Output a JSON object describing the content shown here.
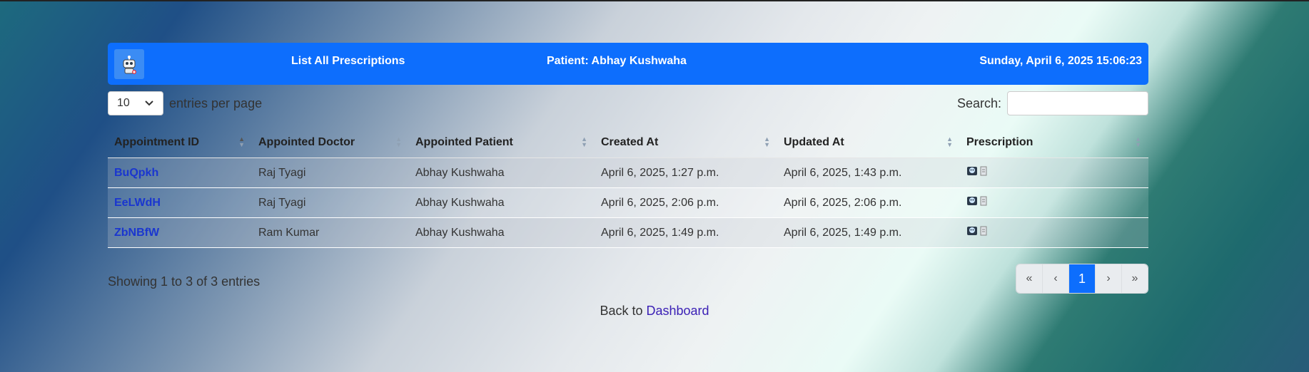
{
  "header": {
    "title": "List All Prescriptions",
    "patient": "Patient: Abhay Kushwaha",
    "datetime": "Sunday, April 6, 2025 15:06:23",
    "logo_icon": "robot-doctor-icon",
    "bar_color": "#0d6efd"
  },
  "controls": {
    "per_page_value": "10",
    "per_page_label": "entries per page",
    "search_label": "Search:",
    "search_placeholder": ""
  },
  "table": {
    "columns": [
      "Appointment ID",
      "Appointed Doctor",
      "Appointed Patient",
      "Created At",
      "Updated At",
      "Prescription"
    ],
    "rows": [
      {
        "id": "BuQpkh",
        "doctor": "Raj Tyagi",
        "patient": "Abhay Kushwaha",
        "created": "April 6, 2025, 1:27 p.m.",
        "updated": "April 6, 2025, 1:43 p.m."
      },
      {
        "id": "EeLWdH",
        "doctor": "Raj Tyagi",
        "patient": "Abhay Kushwaha",
        "created": "April 6, 2025, 2:06 p.m.",
        "updated": "April 6, 2025, 2:06 p.m."
      },
      {
        "id": "ZbNBfW",
        "doctor": "Ram Kumar",
        "patient": "Abhay Kushwaha",
        "created": "April 6, 2025, 1:49 p.m.",
        "updated": "April 6, 2025, 1:49 p.m."
      }
    ]
  },
  "footer": {
    "showing": "Showing 1 to 3 of 3 entries",
    "pager": {
      "first": "«",
      "prev": "‹",
      "current": "1",
      "next": "›",
      "last": "»"
    },
    "back_text": "Back to",
    "back_link": "Dashboard"
  }
}
